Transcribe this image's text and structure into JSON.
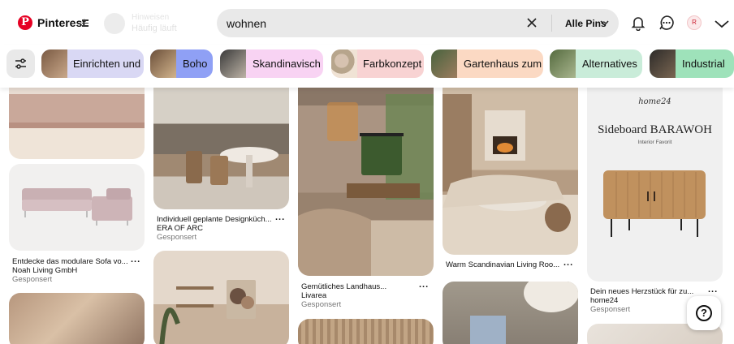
{
  "header": {
    "brand": "Pinterest",
    "ghost_line1": "Hinweisen",
    "ghost_line2": "Häufig läuft",
    "search_value": "wohnen",
    "scope_label": "Alle Pins",
    "avatar_initial": "R"
  },
  "chips": [
    {
      "label": "Einrichten und",
      "color": "#d9d8f4"
    },
    {
      "label": "Boho",
      "color": "#8fa0f5"
    },
    {
      "label": "Skandinavisch",
      "color": "#f8d3f3"
    },
    {
      "label": "Farbkonzept",
      "color": "#f8d3d3"
    },
    {
      "label": "Gartenhaus zum",
      "color": "#fbd9c3"
    },
    {
      "label": "Alternatives",
      "color": "#c9ecd9"
    },
    {
      "label": "Industrial",
      "color": "#9ee2ba"
    }
  ],
  "pins": [
    {
      "title": "Entdecke das modulare Sofa vo...",
      "source": "Noah Living GmbH",
      "sponsored": "Gesponsert"
    },
    {
      "title": "Individuell geplante Designküch...",
      "source": "ERA OF ARC",
      "sponsored": "Gesponsert"
    },
    {
      "title": "Gemütliches Landhaus...",
      "source": "Livarea",
      "sponsored": "Gesponsert"
    },
    {
      "title": "Warm Scandinavian Living Roo...",
      "source": "",
      "sponsored": ""
    },
    {
      "title": "Dein neues Herzstück für zu...",
      "source": "home24",
      "sponsored": "Gesponsert"
    }
  ],
  "ad": {
    "brand": "home24",
    "headline": "Sideboard BARAWOH",
    "subline": "Interior Favorit"
  },
  "more_label": "...",
  "help_label": "?"
}
